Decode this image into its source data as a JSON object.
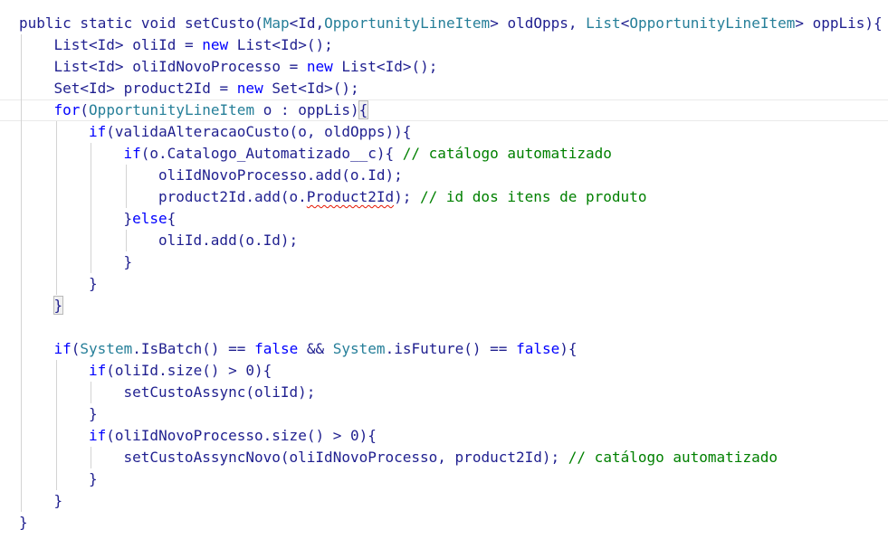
{
  "editor": {
    "language": "apex",
    "colors": {
      "keyword": "#0000ff",
      "type": "#267f99",
      "plain": "#1f1f8f",
      "comment": "#008000",
      "error_squiggle": "#e51400"
    },
    "lines": [
      {
        "indent": 0,
        "tokens": [
          {
            "t": "public static void setCusto(",
            "c": "pl"
          },
          {
            "t": "Map",
            "c": "ty"
          },
          {
            "t": "<Id,",
            "c": "pl"
          },
          {
            "t": "OpportunityLineItem",
            "c": "ty"
          },
          {
            "t": "> oldOpps, ",
            "c": "pl"
          },
          {
            "t": "List",
            "c": "ty"
          },
          {
            "t": "<",
            "c": "pl"
          },
          {
            "t": "OpportunityLineItem",
            "c": "ty"
          },
          {
            "t": "> oppLis){",
            "c": "pl"
          }
        ]
      },
      {
        "indent": 1,
        "tokens": [
          {
            "t": "List<Id> oliId = ",
            "c": "pl"
          },
          {
            "t": "new",
            "c": "kw"
          },
          {
            "t": " List<Id>();",
            "c": "pl"
          }
        ]
      },
      {
        "indent": 1,
        "tokens": [
          {
            "t": "List<Id> oliIdNovoProcesso = ",
            "c": "pl"
          },
          {
            "t": "new",
            "c": "kw"
          },
          {
            "t": " List<Id>();",
            "c": "pl"
          }
        ]
      },
      {
        "indent": 1,
        "tokens": [
          {
            "t": "Set<Id> product2Id = ",
            "c": "pl"
          },
          {
            "t": "new",
            "c": "kw"
          },
          {
            "t": " Set<Id>();",
            "c": "pl"
          }
        ]
      },
      {
        "indent": 1,
        "highlight": true,
        "tokens": [
          {
            "t": "for",
            "c": "kw"
          },
          {
            "t": "(",
            "c": "pl"
          },
          {
            "t": "OpportunityLineItem",
            "c": "ty"
          },
          {
            "t": " o : oppLis)",
            "c": "pl"
          },
          {
            "t": "{",
            "c": "pl",
            "brace": true
          }
        ]
      },
      {
        "indent": 2,
        "tokens": [
          {
            "t": "if",
            "c": "kw"
          },
          {
            "t": "(validaAlteracaoCusto(o, oldOpps)){",
            "c": "pl"
          }
        ]
      },
      {
        "indent": 3,
        "tokens": [
          {
            "t": "if",
            "c": "kw"
          },
          {
            "t": "(o.Catalogo_Automatizado__c){ ",
            "c": "pl"
          },
          {
            "t": "// catálogo automatizado",
            "c": "cm"
          }
        ]
      },
      {
        "indent": 4,
        "tokens": [
          {
            "t": "oliIdNovoProcesso.add(o.Id);",
            "c": "pl"
          }
        ]
      },
      {
        "indent": 4,
        "tokens": [
          {
            "t": "product2Id.add(o.",
            "c": "pl"
          },
          {
            "t": "Product2Id",
            "c": "pl",
            "squiggle": true
          },
          {
            "t": "); ",
            "c": "pl"
          },
          {
            "t": "// id dos itens de produto",
            "c": "cm"
          }
        ]
      },
      {
        "indent": 3,
        "tokens": [
          {
            "t": "}",
            "c": "pl"
          },
          {
            "t": "else",
            "c": "kw"
          },
          {
            "t": "{",
            "c": "pl"
          }
        ]
      },
      {
        "indent": 4,
        "tokens": [
          {
            "t": "oliId.add(o.Id);",
            "c": "pl"
          }
        ]
      },
      {
        "indent": 3,
        "tokens": [
          {
            "t": "}",
            "c": "pl"
          }
        ]
      },
      {
        "indent": 2,
        "tokens": [
          {
            "t": "}",
            "c": "pl"
          }
        ]
      },
      {
        "indent": 1,
        "tokens": [
          {
            "t": "}",
            "c": "pl",
            "brace": true
          }
        ]
      },
      {
        "indent": 0,
        "tokens": []
      },
      {
        "indent": 1,
        "tokens": [
          {
            "t": "if",
            "c": "kw"
          },
          {
            "t": "(",
            "c": "pl"
          },
          {
            "t": "System",
            "c": "ty"
          },
          {
            "t": ".IsBatch() == ",
            "c": "pl"
          },
          {
            "t": "false",
            "c": "kw"
          },
          {
            "t": " && ",
            "c": "pl"
          },
          {
            "t": "System",
            "c": "ty"
          },
          {
            "t": ".isFuture() == ",
            "c": "pl"
          },
          {
            "t": "false",
            "c": "kw"
          },
          {
            "t": "){",
            "c": "pl"
          }
        ]
      },
      {
        "indent": 2,
        "tokens": [
          {
            "t": "if",
            "c": "kw"
          },
          {
            "t": "(oliId.size() > 0){",
            "c": "pl"
          }
        ]
      },
      {
        "indent": 3,
        "tokens": [
          {
            "t": "setCustoAssync(oliId);",
            "c": "pl"
          }
        ]
      },
      {
        "indent": 2,
        "tokens": [
          {
            "t": "}",
            "c": "pl"
          }
        ]
      },
      {
        "indent": 2,
        "tokens": [
          {
            "t": "if",
            "c": "kw"
          },
          {
            "t": "(oliIdNovoProcesso.size() > 0){",
            "c": "pl"
          }
        ]
      },
      {
        "indent": 3,
        "tokens": [
          {
            "t": "setCustoAssyncNovo(oliIdNovoProcesso, product2Id); ",
            "c": "pl"
          },
          {
            "t": "// catálogo automatizado",
            "c": "cm"
          }
        ]
      },
      {
        "indent": 2,
        "tokens": [
          {
            "t": "}",
            "c": "pl"
          }
        ]
      },
      {
        "indent": 1,
        "tokens": [
          {
            "t": "}",
            "c": "pl"
          }
        ]
      },
      {
        "indent": 0,
        "tokens": [
          {
            "t": "}",
            "c": "pl"
          }
        ]
      }
    ]
  }
}
